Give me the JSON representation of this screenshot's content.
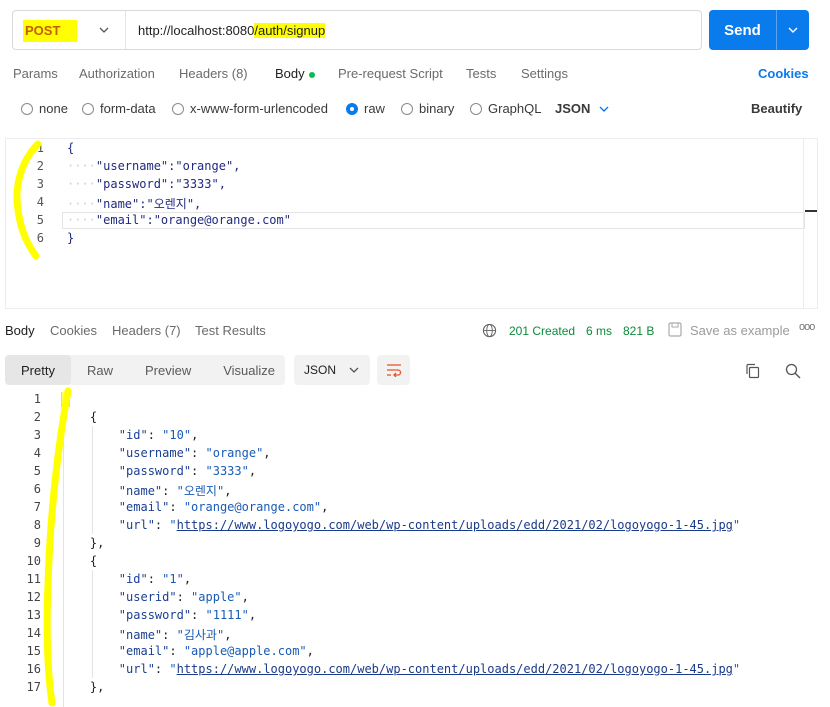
{
  "request": {
    "method": "POST",
    "url_prefix": "http://localhost:8080",
    "url_highlight": "/auth/signup",
    "send_label": "Send"
  },
  "request_tabs": {
    "params": "Params",
    "authorization": "Authorization",
    "headers": "Headers (8)",
    "body": "Body",
    "pre_request": "Pre-request Script",
    "tests": "Tests",
    "settings": "Settings",
    "cookies": "Cookies"
  },
  "body_options": {
    "none": "none",
    "form_data": "form-data",
    "urlencoded": "x-www-form-urlencoded",
    "raw": "raw",
    "binary": "binary",
    "graphql": "GraphQL",
    "format": "JSON",
    "beautify": "Beautify",
    "selected": "raw"
  },
  "request_body": {
    "line_numbers": [
      "1",
      "2",
      "3",
      "4",
      "5",
      "6"
    ],
    "lines": [
      "{",
      "    \"username\":\"orange\",",
      "    \"password\":\"3333\",",
      "    \"name\":\"오렌지\",",
      "    \"email\":\"orange@orange.com\"",
      "}"
    ]
  },
  "response_tabs": {
    "body": "Body",
    "cookies": "Cookies",
    "headers": "Headers (7)",
    "test_results": "Test Results"
  },
  "response_status": {
    "status": "201 Created",
    "time": "6 ms",
    "size": "821 B",
    "save_label": "Save as example",
    "more": "ooo"
  },
  "view_modes": {
    "pretty": "Pretty",
    "raw": "Raw",
    "preview": "Preview",
    "visualize": "Visualize",
    "format": "JSON"
  },
  "response_body": {
    "line_numbers": [
      "1",
      "2",
      "3",
      "4",
      "5",
      "6",
      "7",
      "8",
      "9",
      "10",
      "11",
      "12",
      "13",
      "14",
      "15",
      "16",
      "17"
    ],
    "lines": [
      "[",
      "    {",
      "        \"id\": \"10\",",
      "        \"username\": \"orange\",",
      "        \"password\": \"3333\",",
      "        \"name\": \"오렌지\",",
      "        \"email\": \"orange@orange.com\",",
      "        \"url\": \"https://www.logoyogo.com/web/wp-content/uploads/edd/2021/02/logoyogo-1-45.jpg\"",
      "    },",
      "    {",
      "        \"id\": \"1\",",
      "        \"userid\": \"apple\",",
      "        \"password\": \"1111\",",
      "        \"name\": \"김사과\",",
      "        \"email\": \"apple@apple.com\",",
      "        \"url\": \"https://www.logoyogo.com/web/wp-content/uploads/edd/2021/02/logoyogo-1-45.jpg\"",
      "    },"
    ]
  },
  "colors": {
    "accent": "#097bed",
    "method": "#c75d00",
    "highlight": "#ffff00",
    "status_ok": "#0a8a3a"
  }
}
